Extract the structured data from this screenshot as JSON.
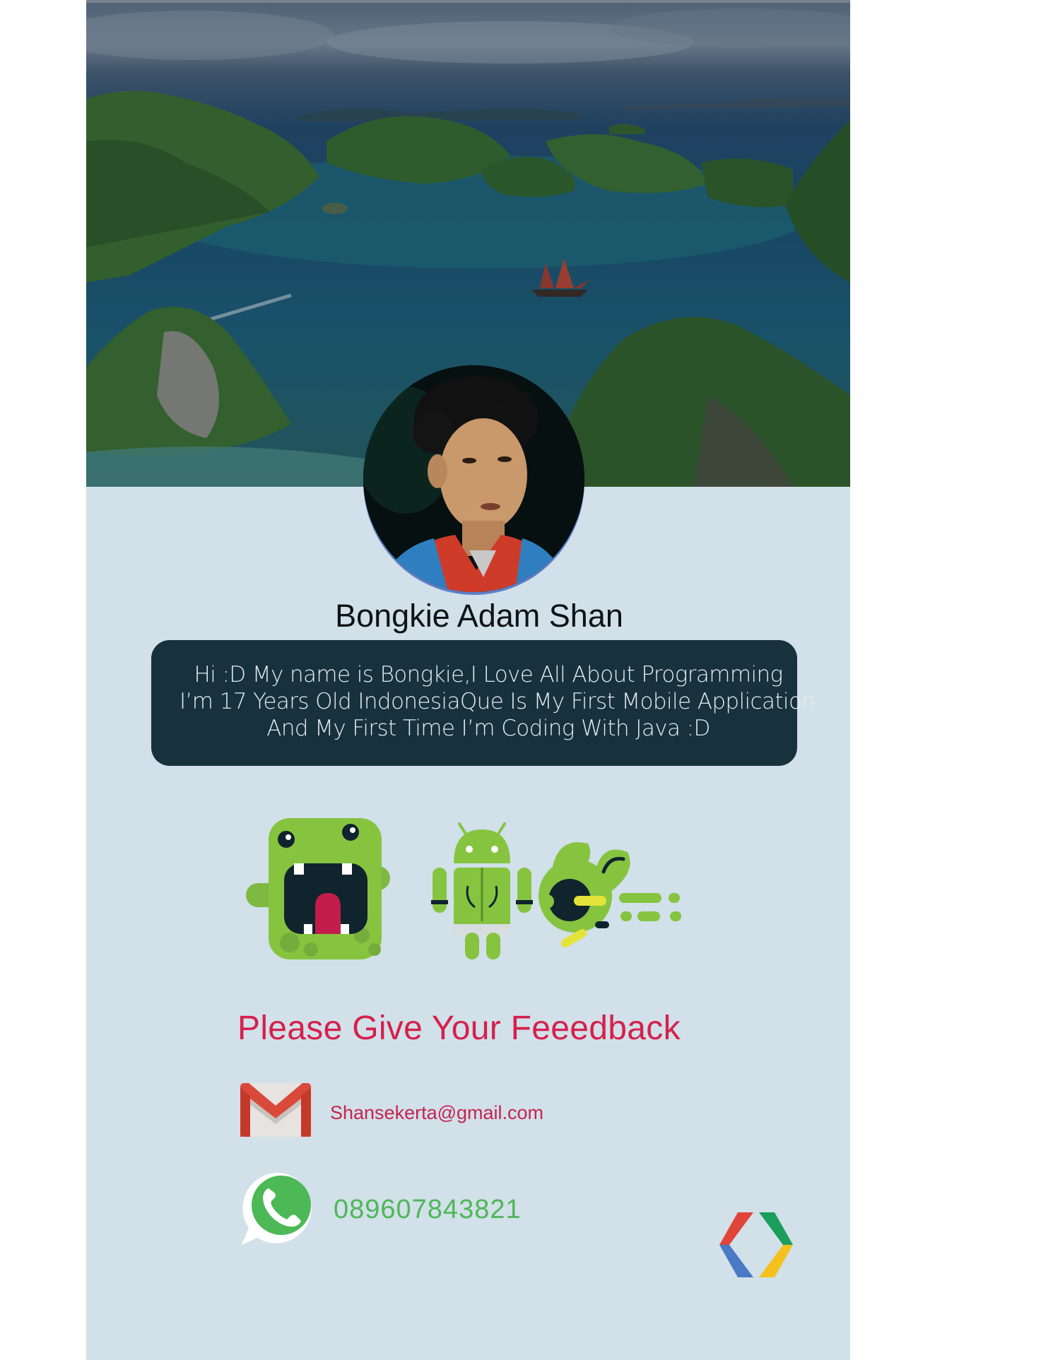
{
  "profile": {
    "name": "Bongkie Adam Shan",
    "bio_lines": [
      "Hi :D My name is Bongkie,I Love All About Programming",
      "I’m 17 Years Old IndonesiaQue Is My First Mobile Application",
      "And My First Time I’m Coding With Java :D"
    ]
  },
  "feedback": {
    "heading": "Please Give Your Feeedback",
    "email": "Shansekerta@gmail.com",
    "phone": "089607843821"
  },
  "icons": {
    "header": "island-landscape-photo",
    "avatar": "profile-photo",
    "mascots": [
      "green-monster-icon",
      "android-robot-icon",
      "green-bird-icon"
    ],
    "email": "gmail-icon",
    "phone": "whatsapp-icon",
    "logo": "google-developers-icon"
  },
  "colors": {
    "background": "#d1e0e9",
    "bio_card": "#17313d",
    "heading": "#d6204c",
    "email": "#c6244e",
    "phone": "#4eb757"
  }
}
